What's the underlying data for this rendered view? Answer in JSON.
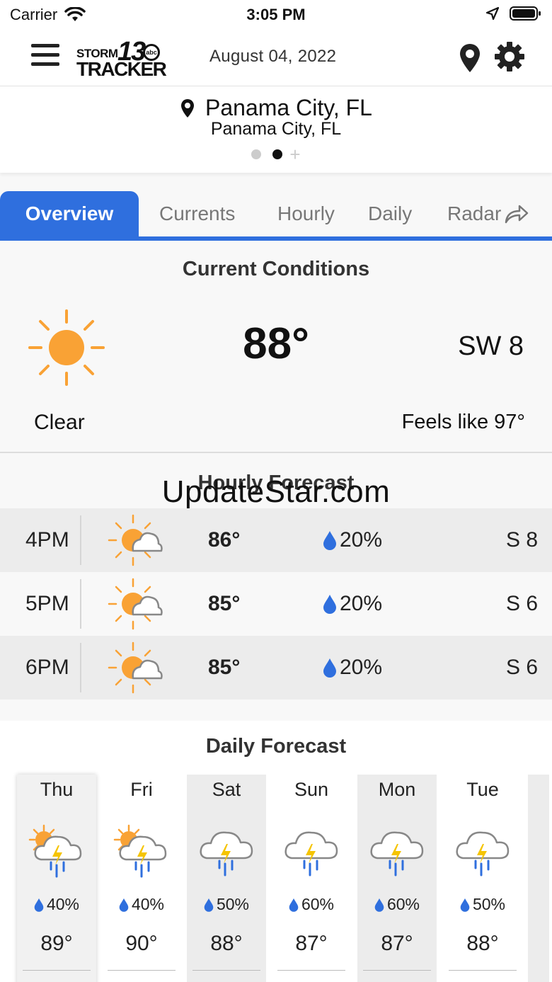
{
  "status_bar": {
    "carrier": "Carrier",
    "time": "3:05 PM"
  },
  "header": {
    "logo": {
      "storm": "STORM",
      "number": "13",
      "network": "abc",
      "tracker": "TRACKER"
    },
    "date": "August 04, 2022"
  },
  "location": {
    "name": "Panama City, FL",
    "subtitle": "Panama City, FL",
    "pager": {
      "count": 2,
      "active_index": 1
    }
  },
  "tabs": [
    {
      "label": "Overview",
      "active": true
    },
    {
      "label": "Currents",
      "active": false
    },
    {
      "label": "Hourly",
      "active": false
    },
    {
      "label": "Daily",
      "active": false
    },
    {
      "label": "Radar",
      "active": false
    }
  ],
  "current_conditions": {
    "title": "Current Conditions",
    "icon": "sun-icon",
    "temperature": "88°",
    "wind": "SW 8",
    "condition": "Clear",
    "feels_like": "Feels like 97°"
  },
  "hourly_forecast": {
    "title": "Hourly Forecast",
    "rows": [
      {
        "time": "4PM",
        "icon": "partly-cloudy-icon",
        "temp": "86°",
        "precip": "20%",
        "wind": "S 8"
      },
      {
        "time": "5PM",
        "icon": "partly-cloudy-icon",
        "temp": "85°",
        "precip": "20%",
        "wind": "S 6"
      },
      {
        "time": "6PM",
        "icon": "partly-cloudy-icon",
        "temp": "85°",
        "precip": "20%",
        "wind": "S 6"
      }
    ]
  },
  "watermark": "UpdateStar.com",
  "daily_forecast": {
    "title": "Daily Forecast",
    "days": [
      {
        "day": "Thu",
        "icon": "sun-thunderstorm-icon",
        "precip": "40%",
        "temp": "89°"
      },
      {
        "day": "Fri",
        "icon": "sun-thunderstorm-icon",
        "precip": "40%",
        "temp": "90°"
      },
      {
        "day": "Sat",
        "icon": "thunderstorm-icon",
        "precip": "50%",
        "temp": "88°"
      },
      {
        "day": "Sun",
        "icon": "thunderstorm-icon",
        "precip": "60%",
        "temp": "87°"
      },
      {
        "day": "Mon",
        "icon": "thunderstorm-icon",
        "precip": "60%",
        "temp": "87°"
      },
      {
        "day": "Tue",
        "icon": "thunderstorm-icon",
        "precip": "50%",
        "temp": "88°"
      }
    ]
  },
  "colors": {
    "accent": "#2f6fde",
    "sun": "#f9a235",
    "precip_drop": "#2f6fde"
  }
}
